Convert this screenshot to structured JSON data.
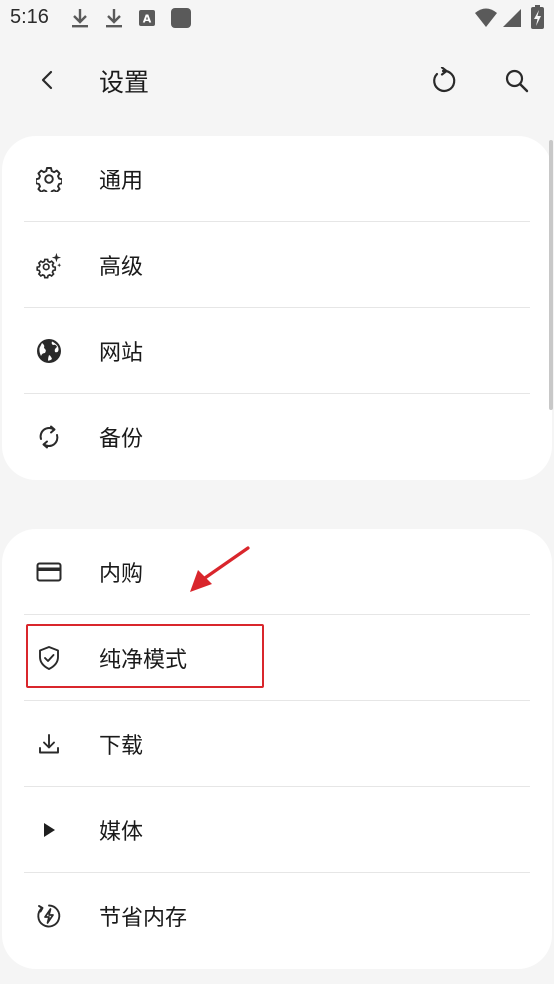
{
  "status_bar": {
    "time": "5:16",
    "icons": [
      "download-icon",
      "download-icon",
      "text-a-icon",
      "app-square-icon",
      "wifi-icon",
      "signal-icon",
      "battery-charging-icon"
    ]
  },
  "app_bar": {
    "title": "设置",
    "back_icon": "chevron-left-icon",
    "refresh_icon": "refresh-icon",
    "search_icon": "search-icon"
  },
  "groups": [
    {
      "items": [
        {
          "label": "通用",
          "icon": "gear-icon"
        },
        {
          "label": "高级",
          "icon": "gear-sparkle-icon"
        },
        {
          "label": "网站",
          "icon": "globe-icon"
        },
        {
          "label": "备份",
          "icon": "sync-icon"
        }
      ]
    },
    {
      "items": [
        {
          "label": "内购",
          "icon": "credit-card-icon"
        },
        {
          "label": "纯净模式",
          "icon": "shield-check-icon"
        },
        {
          "label": "下载",
          "icon": "download-icon"
        },
        {
          "label": "媒体",
          "icon": "play-icon"
        },
        {
          "label": "节省内存",
          "icon": "bolt-circle-icon"
        }
      ]
    }
  ],
  "annotation": {
    "highlight_color": "#d9262c",
    "highlighted_item": "纯净模式"
  }
}
